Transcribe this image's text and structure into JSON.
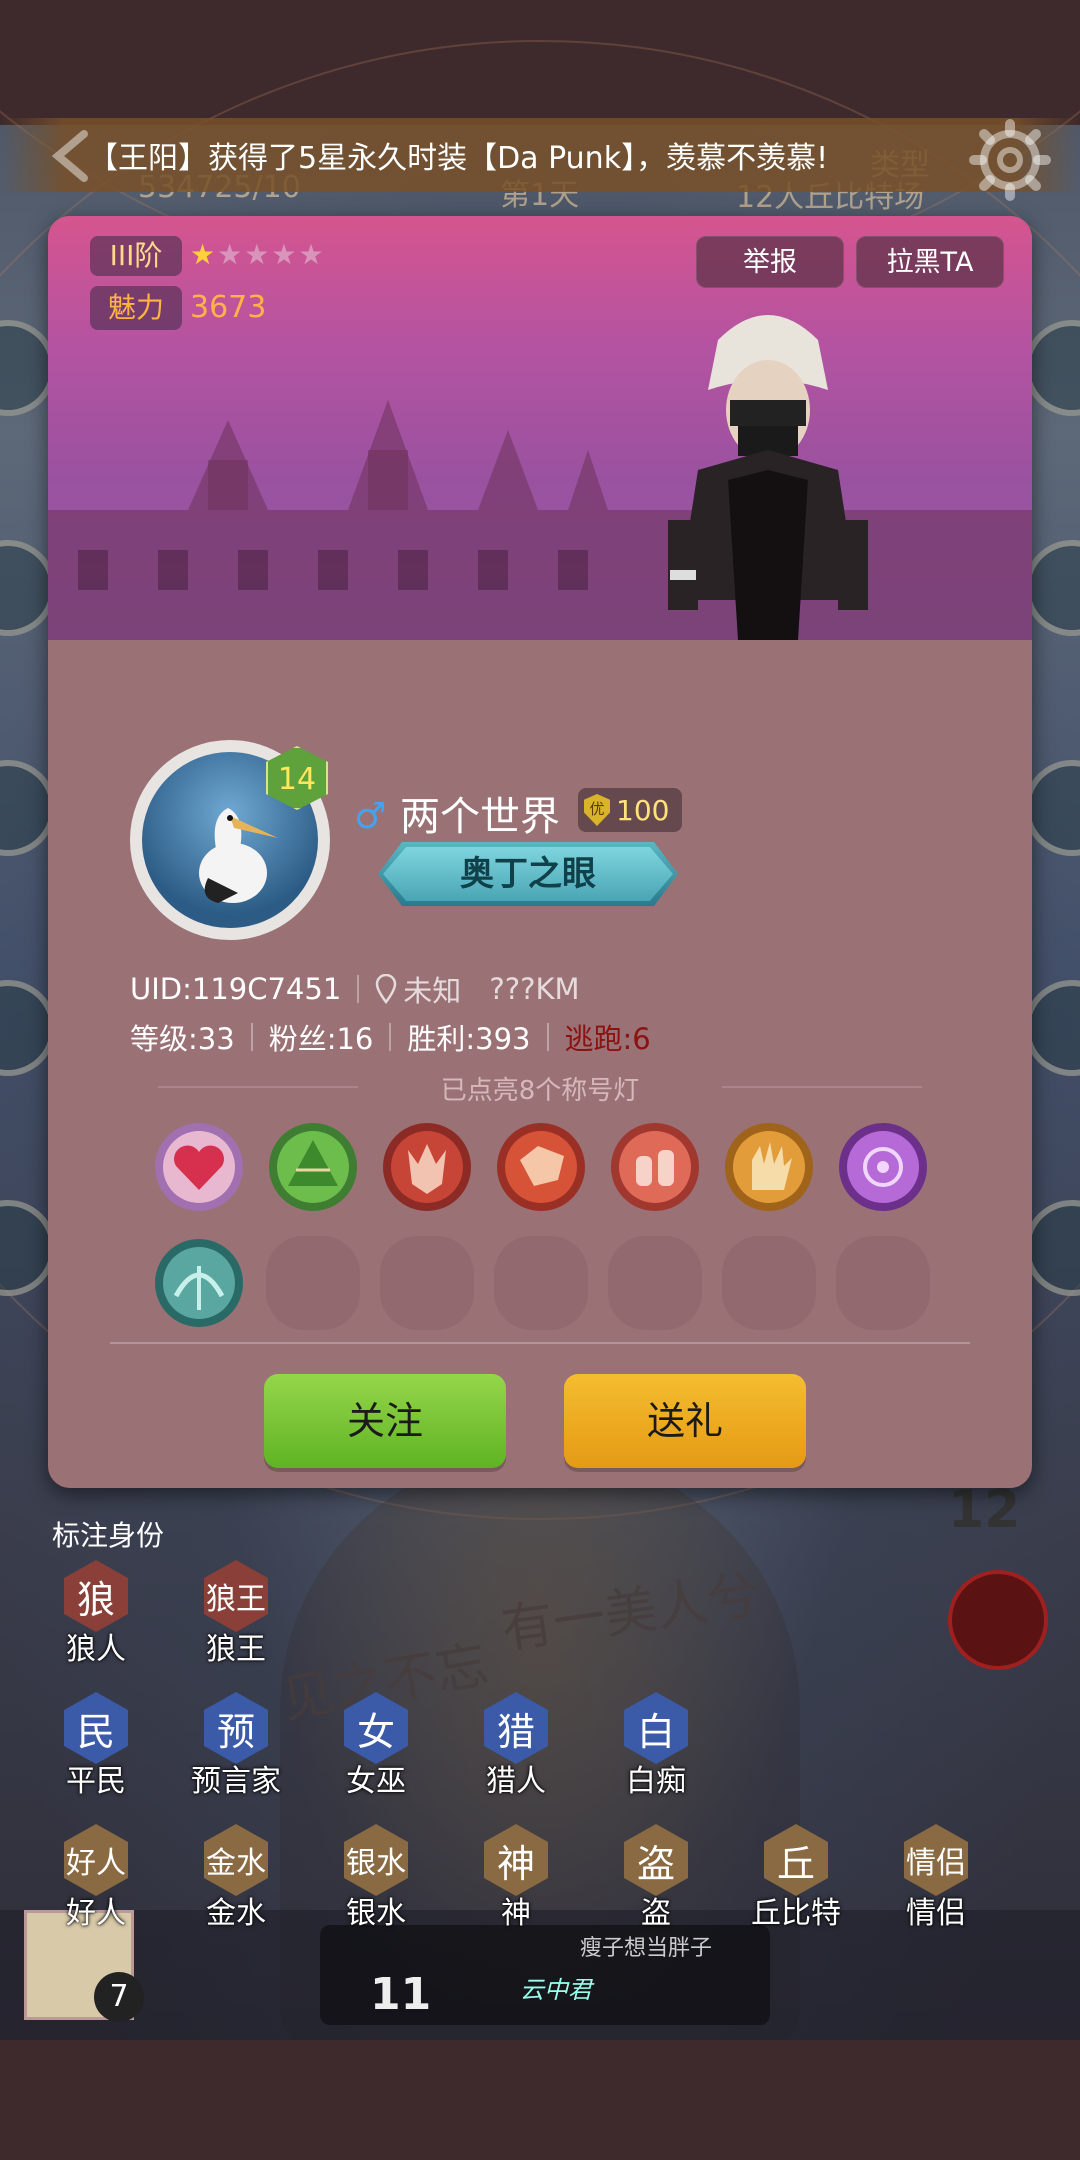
{
  "marquee": {
    "text": "【王阳】获得了5星永久时装【Da Punk】，羡慕不羡慕!"
  },
  "profile": {
    "rank": "III阶",
    "stars": {
      "filled": 1,
      "total": 5
    },
    "charm_label": "魅力",
    "charm_value": "3673",
    "report_label": "举报",
    "block_label": "拉黑TA",
    "level_badge": "14",
    "gender_symbol": "♂",
    "nickname": "两个世界",
    "vip_letter": "优",
    "vip_value": "100",
    "title_badge": "奥丁之眼",
    "uid": "UID:119C7451",
    "location": "未知",
    "distance": "???KM",
    "level": "等级:33",
    "fans": "粉丝:16",
    "wins": "胜利:393",
    "escapes": "逃跑:6",
    "lights_caption": "已点亮8个称号灯",
    "lights": [
      {
        "icon": "heart-icon",
        "color": "#c44a6a"
      },
      {
        "icon": "zongzi-icon",
        "color": "#4a9a3a"
      },
      {
        "icon": "werewolf-icon",
        "color": "#c04030"
      },
      {
        "icon": "wolf-king-icon",
        "color": "#d04a30"
      },
      {
        "icon": "potion-icon",
        "color": "#d85a4a"
      },
      {
        "icon": "claw-hand-icon",
        "color": "#d98a28"
      },
      {
        "icon": "magic-seal-icon",
        "color": "#a050c8"
      },
      {
        "icon": "crossbow-icon",
        "color": "#3a8a8a"
      }
    ],
    "follow_label": "关注",
    "gift_label": "送礼"
  },
  "roles": {
    "title": "标注身份",
    "items": [
      {
        "glyph": "狼",
        "label": "狼人",
        "team": "wolf"
      },
      {
        "glyph": "狼王",
        "label": "狼王",
        "team": "wolf"
      },
      {
        "glyph": "民",
        "label": "平民",
        "team": "good"
      },
      {
        "glyph": "预",
        "label": "预言家",
        "team": "good"
      },
      {
        "glyph": "女",
        "label": "女巫",
        "team": "good"
      },
      {
        "glyph": "猎",
        "label": "猎人",
        "team": "good"
      },
      {
        "glyph": "白",
        "label": "白痴",
        "team": "good"
      },
      {
        "glyph": "好人",
        "label": "好人",
        "team": "other"
      },
      {
        "glyph": "金水",
        "label": "金水",
        "team": "other"
      },
      {
        "glyph": "银水",
        "label": "银水",
        "team": "other"
      },
      {
        "glyph": "神",
        "label": "神",
        "team": "other"
      },
      {
        "glyph": "盗",
        "label": "盗",
        "team": "other"
      },
      {
        "glyph": "丘",
        "label": "丘比特",
        "team": "other"
      },
      {
        "glyph": "情侣",
        "label": "情侣",
        "team": "other"
      }
    ]
  },
  "background": {
    "player_count": "7",
    "player_count_2": "11",
    "seat_number": "12",
    "day_label": "第1天",
    "room_id": "534725/10",
    "mode_label": "类型",
    "mode_value": "12人丘比特场",
    "poem_1": "有一美人兮",
    "poem_2": "见之不忘",
    "nickname_hint": "瘦子想当胖子",
    "skin_label": "云中君"
  }
}
